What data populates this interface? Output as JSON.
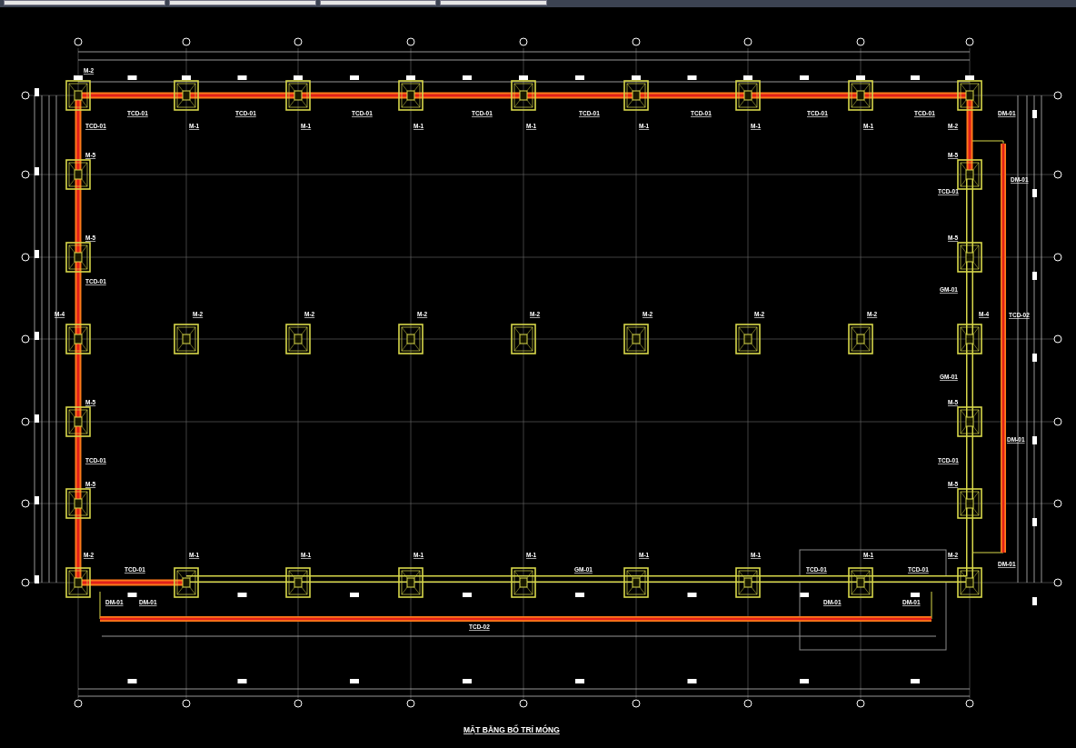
{
  "top_footings": [
    "M-2",
    "M-1",
    "M-1",
    "M-1",
    "M-1",
    "M-1",
    "M-1",
    "M-1",
    "M-2"
  ],
  "top_beams": [
    "TCD-01",
    "TCD-01",
    "TCD-01",
    "TCD-01",
    "TCD-01",
    "TCD-01",
    "TCD-01",
    "TCD-01"
  ],
  "left_footings": [
    "M-5",
    "M-5",
    "M-4",
    "M-5",
    "M-5"
  ],
  "left_beams": [
    "TCD-01",
    "TCD-01",
    "TCD-01"
  ],
  "middle_footings": [
    "M-2",
    "M-2",
    "M-2",
    "M-2",
    "M-2",
    "M-2",
    "M-2"
  ],
  "right_footings": [
    "M-5",
    "M-5",
    "M-4",
    "M-5",
    "M-5"
  ],
  "right_beams": [
    "TCD-01",
    "GM-01",
    "GM-01",
    "TCD-01"
  ],
  "right_ground_beams": [
    "DM-01",
    "DM-01",
    "TCD-02",
    "DM-01",
    "DM-01"
  ],
  "bottom_footings": [
    "M-2",
    "M-1",
    "M-1",
    "M-1",
    "M-1",
    "M-1",
    "M-1",
    "M-1",
    "M-2"
  ],
  "bottom_beams": [
    "TCD-01",
    "GM-01",
    "TCD-01",
    "TCD-01"
  ],
  "bottom_ground_beams": [
    "DM-01",
    "DM-01",
    "DM-01",
    "DM-01",
    "TCD-02"
  ],
  "title": "MẶT BẰNG BỐ TRÍ MÓNG"
}
